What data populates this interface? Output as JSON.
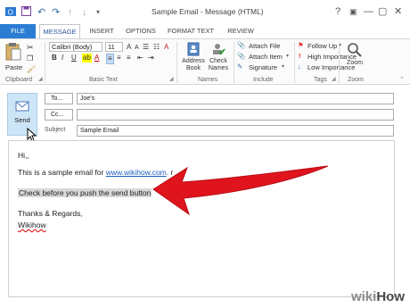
{
  "window": {
    "title": "Sample Email - Message (HTML)",
    "controls": [
      "?",
      "▣",
      "—",
      "▢",
      "✕"
    ]
  },
  "qat": {
    "items": [
      "save-icon",
      "undo-icon",
      "redo-icon",
      "up-icon",
      "down-icon",
      "customize-icon"
    ]
  },
  "tabs": [
    "FILE",
    "MESSAGE",
    "INSERT",
    "OPTIONS",
    "FORMAT TEXT",
    "REVIEW"
  ],
  "ribbon": {
    "clipboard": {
      "paste": "Paste",
      "label": "Clipboard"
    },
    "basic_text": {
      "font": "Calibri (Body)",
      "size": "11",
      "label": "Basic Text",
      "bold": "B",
      "italic": "I",
      "underline": "U"
    },
    "names": {
      "address_book": [
        "Address",
        "Book"
      ],
      "check_names": [
        "Check",
        "Names"
      ],
      "label": "Names"
    },
    "include": {
      "attach_file": "Attach File",
      "attach_item": "Attach Item",
      "signature": "Signature",
      "label": "Include"
    },
    "tags": {
      "follow_up": "Follow Up",
      "high": "High Importance",
      "low": "Low Importance",
      "label": "Tags"
    },
    "zoom": {
      "label": "Zoom"
    }
  },
  "compose": {
    "send": "Send",
    "to_label": "To...",
    "to_value": "Joe's",
    "cc_label": "Cc...",
    "cc_value": "",
    "subject_label": "Subject",
    "subject_value": "Sample Email"
  },
  "body": {
    "greeting": "Hi,,",
    "line1_prefix": "This is a sample email for ",
    "link": "www.wikihow.com",
    "line1_suffix": ". r",
    "highlight": "Check before you push the send button",
    "closing": "Thanks & Regards,",
    "signature": "Wikihow"
  },
  "watermark": {
    "prefix": "wiki",
    "suffix": "How"
  },
  "colors": {
    "accent": "#2b7cd3",
    "arrow": "#e0141d",
    "send_bg": "#cde6f7"
  }
}
